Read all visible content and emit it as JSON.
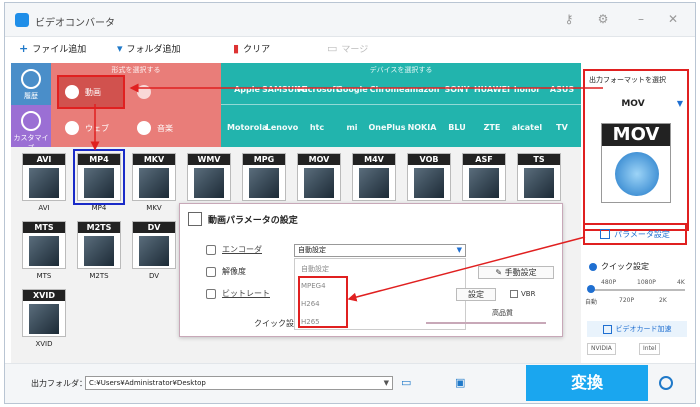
{
  "app": {
    "title": "ビデオコンバータ"
  },
  "toolbar": {
    "add_file": "ファイル追加",
    "add_folder": "フォルダ追加",
    "clear": "クリア",
    "merge": "マージ"
  },
  "leftnav": {
    "history": "履歴",
    "customize": "カスタマイズ"
  },
  "formats_section": {
    "label": "形式を選択する",
    "video": "動画",
    "web": "ウェブ",
    "music": "音楽"
  },
  "devices_section": {
    "label": "デバイスを選択する",
    "row1": [
      "Apple",
      "SAMSUNG",
      "Microsoft",
      "Google",
      "Chrome",
      "amazon",
      "SONY",
      "HUAWEI",
      "honor",
      "ASUS"
    ],
    "row2": [
      "Motorola",
      "Lenovo",
      "htc",
      "mi",
      "OnePlus",
      "NOKIA",
      "BLU",
      "ZTE",
      "alcatel",
      "TV"
    ]
  },
  "tiles": [
    {
      "name": "AVI"
    },
    {
      "name": "MP4"
    },
    {
      "name": "MKV"
    },
    {
      "name": "WMV"
    },
    {
      "name": "MPG"
    },
    {
      "name": "MOV"
    },
    {
      "name": "M4V"
    },
    {
      "name": "VOB"
    },
    {
      "name": "ASF"
    },
    {
      "name": "TS"
    },
    {
      "name": "MTS"
    },
    {
      "name": "M2TS"
    },
    {
      "name": "DV"
    },
    {
      "name": "XVID"
    }
  ],
  "dialog": {
    "title": "動画パラメータの設定",
    "encoder": "エンコーダ",
    "resolution": "解像度",
    "bitrate": "ビットレート",
    "quick_setting": "クイック設定",
    "selected": "自動設定",
    "options": [
      "自動設定",
      "MPEG4",
      "H264",
      "H265"
    ],
    "manual": "手動設定",
    "set": "設定",
    "vbr": "VBR",
    "high_quality": "高品質"
  },
  "output": {
    "label": "出力フォーマットを選択",
    "format": "MOV",
    "param": "パラメータ設定",
    "quick": "クイック設定",
    "speed_top": [
      "480P",
      "1080P",
      "4K"
    ],
    "speed_bot": [
      "自動",
      "720P",
      "2K"
    ],
    "gpu": "ビデオカード加速",
    "nvidia": "NVIDIA",
    "intel": "Intel"
  },
  "bottom": {
    "folder_label": "出力フォルダ：",
    "path": "C:¥Users¥Administrator¥Desktop",
    "convert": "変換"
  }
}
